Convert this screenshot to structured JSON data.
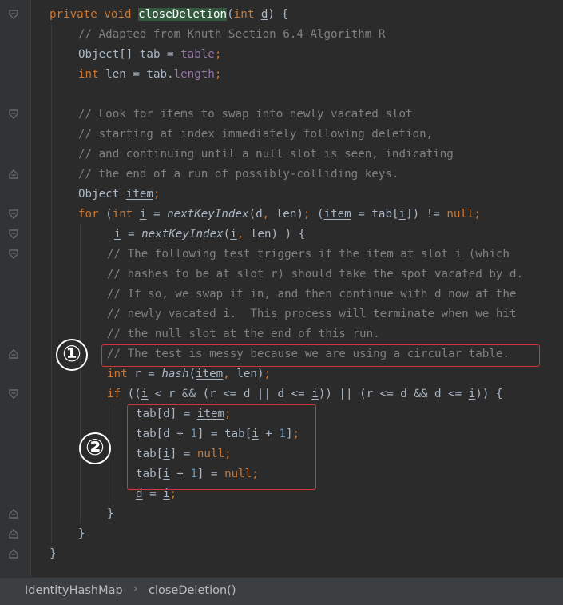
{
  "code": {
    "lines": [
      {
        "segments": [
          {
            "t": "private ",
            "c": "kw"
          },
          {
            "t": "void ",
            "c": "kw"
          },
          {
            "t": "closeDeletion",
            "c": "hl"
          },
          {
            "t": "("
          },
          {
            "t": "int ",
            "c": "kw"
          },
          {
            "t": "d",
            "c": "ul"
          },
          {
            "t": ") {"
          }
        ]
      },
      {
        "segments": [
          {
            "t": "// Adapted from Knuth Section 6.4 Algorithm R",
            "c": "cm"
          }
        ]
      },
      {
        "segments": [
          {
            "t": "Object[] tab = "
          },
          {
            "t": "table",
            "c": "fld"
          },
          {
            "t": ";",
            "c": "kw"
          }
        ]
      },
      {
        "segments": [
          {
            "t": "int ",
            "c": "kw"
          },
          {
            "t": "len = tab."
          },
          {
            "t": "length",
            "c": "fld"
          },
          {
            "t": ";",
            "c": "kw"
          }
        ]
      },
      {
        "segments": []
      },
      {
        "segments": [
          {
            "t": "// Look for items to swap into newly vacated slot",
            "c": "cm"
          }
        ]
      },
      {
        "segments": [
          {
            "t": "// starting at index immediately following deletion,",
            "c": "cm"
          }
        ]
      },
      {
        "segments": [
          {
            "t": "// and continuing until a null slot is seen, indicating",
            "c": "cm"
          }
        ]
      },
      {
        "segments": [
          {
            "t": "// the end of a run of possibly-colliding keys.",
            "c": "cm"
          }
        ]
      },
      {
        "segments": [
          {
            "t": "Object "
          },
          {
            "t": "item",
            "c": "ul"
          },
          {
            "t": ";",
            "c": "kw"
          }
        ]
      },
      {
        "segments": [
          {
            "t": "for ",
            "c": "kw"
          },
          {
            "t": "("
          },
          {
            "t": "int ",
            "c": "kw"
          },
          {
            "t": "i",
            "c": "ul"
          },
          {
            "t": " = "
          },
          {
            "t": "nextKeyIndex",
            "c": "it"
          },
          {
            "t": "(d"
          },
          {
            "t": ", ",
            "c": "kw"
          },
          {
            "t": "len)"
          },
          {
            "t": "; ",
            "c": "kw"
          },
          {
            "t": "("
          },
          {
            "t": "item",
            "c": "ul"
          },
          {
            "t": " = tab["
          },
          {
            "t": "i",
            "c": "ul"
          },
          {
            "t": "]) != "
          },
          {
            "t": "null",
            "c": "kw"
          },
          {
            "t": ";",
            "c": "kw"
          }
        ]
      },
      {
        "segments": [
          {
            "t": "i",
            "c": "ul"
          },
          {
            "t": " = "
          },
          {
            "t": "nextKeyIndex",
            "c": "it"
          },
          {
            "t": "("
          },
          {
            "t": "i",
            "c": "ul"
          },
          {
            "t": ", ",
            "c": "kw"
          },
          {
            "t": "len) ) {"
          }
        ]
      },
      {
        "segments": [
          {
            "t": "// The following test triggers if the item at slot i (which",
            "c": "cm"
          }
        ]
      },
      {
        "segments": [
          {
            "t": "// hashes to be at slot r) should take the spot vacated by d.",
            "c": "cm"
          }
        ]
      },
      {
        "segments": [
          {
            "t": "// If so, we swap it in, and then continue with d now at the",
            "c": "cm"
          }
        ]
      },
      {
        "segments": [
          {
            "t": "// newly vacated i.  This process will terminate when we hit",
            "c": "cm"
          }
        ]
      },
      {
        "segments": [
          {
            "t": "// the null slot at the end of this run.",
            "c": "cm"
          }
        ]
      },
      {
        "segments": [
          {
            "t": "// The test is messy because we are using a circular table.",
            "c": "cm"
          }
        ]
      },
      {
        "segments": [
          {
            "t": "int ",
            "c": "kw"
          },
          {
            "t": "r = "
          },
          {
            "t": "hash",
            "c": "it"
          },
          {
            "t": "("
          },
          {
            "t": "item",
            "c": "ul"
          },
          {
            "t": ", ",
            "c": "kw"
          },
          {
            "t": "len)"
          },
          {
            "t": ";",
            "c": "kw"
          }
        ]
      },
      {
        "segments": [
          {
            "t": "if ",
            "c": "kw"
          },
          {
            "t": "(("
          },
          {
            "t": "i",
            "c": "ul"
          },
          {
            "t": " < r && (r <= d || d <= "
          },
          {
            "t": "i",
            "c": "ul"
          },
          {
            "t": ")) || (r <= d && d <= "
          },
          {
            "t": "i",
            "c": "ul"
          },
          {
            "t": ")) {"
          }
        ]
      },
      {
        "segments": [
          {
            "t": "tab[d] = "
          },
          {
            "t": "item",
            "c": "ul"
          },
          {
            "t": ";",
            "c": "kw"
          }
        ]
      },
      {
        "segments": [
          {
            "t": "tab[d + "
          },
          {
            "t": "1",
            "c": "num"
          },
          {
            "t": "] = tab["
          },
          {
            "t": "i",
            "c": "ul"
          },
          {
            "t": " + "
          },
          {
            "t": "1",
            "c": "num"
          },
          {
            "t": "]"
          },
          {
            "t": ";",
            "c": "kw"
          }
        ]
      },
      {
        "segments": [
          {
            "t": "tab["
          },
          {
            "t": "i",
            "c": "ul"
          },
          {
            "t": "] = "
          },
          {
            "t": "null",
            "c": "kw"
          },
          {
            "t": ";",
            "c": "kw"
          }
        ]
      },
      {
        "segments": [
          {
            "t": "tab["
          },
          {
            "t": "i",
            "c": "ul"
          },
          {
            "t": " + "
          },
          {
            "t": "1",
            "c": "num"
          },
          {
            "t": "] = "
          },
          {
            "t": "null",
            "c": "kw"
          },
          {
            "t": ";",
            "c": "kw"
          }
        ]
      },
      {
        "segments": [
          {
            "t": "d",
            "c": "ul"
          },
          {
            "t": " = "
          },
          {
            "t": "i",
            "c": "ul"
          },
          {
            "t": ";",
            "c": "kw"
          }
        ]
      },
      {
        "segments": [
          {
            "t": "}"
          }
        ]
      },
      {
        "segments": [
          {
            "t": "}"
          }
        ]
      },
      {
        "segments": [
          {
            "t": "}"
          }
        ]
      }
    ]
  },
  "annotations": {
    "marker_1": "①",
    "marker_2": "②"
  },
  "breadcrumb": {
    "class_name": "IdentityHashMap",
    "method_name": "closeDeletion()",
    "separator": "›"
  },
  "colors": {
    "background": "#2b2b2b",
    "keyword": "#cc7832",
    "comment": "#808080",
    "field": "#9876aa",
    "number": "#6897bb",
    "text": "#a9b7c6",
    "highlight_box": "#d4353b"
  }
}
